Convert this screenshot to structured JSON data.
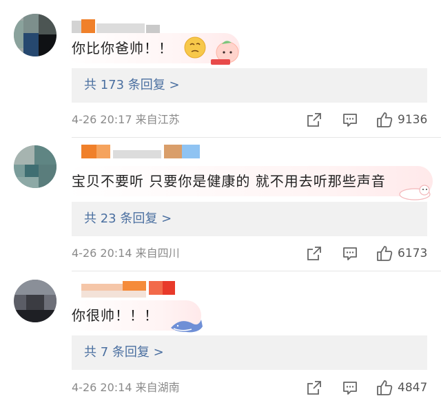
{
  "comments": [
    {
      "text": "你比你爸帅！！",
      "replies": "共 173 条回复 >",
      "time": "4-26 20:17 来自江苏",
      "likes": "9136",
      "emoji": "thinking-face-emoji"
    },
    {
      "text": "宝贝不要听 只要你是健康的 就不用去听那些声音",
      "replies": "共 23 条回复 >",
      "time": "4-26 20:14 来自四川",
      "likes": "6173"
    },
    {
      "text": "你很帅！！！",
      "replies": "共 7 条回复 >",
      "time": "4-26 20:14 来自湖南",
      "likes": "4847"
    }
  ],
  "icons": {
    "share": "share-icon",
    "comment": "comment-icon",
    "like": "thumbs-up-icon"
  },
  "colors": {
    "link": "#4a6fa0",
    "meta": "#8a8a8a",
    "reply_bg": "#f1f1f1"
  }
}
